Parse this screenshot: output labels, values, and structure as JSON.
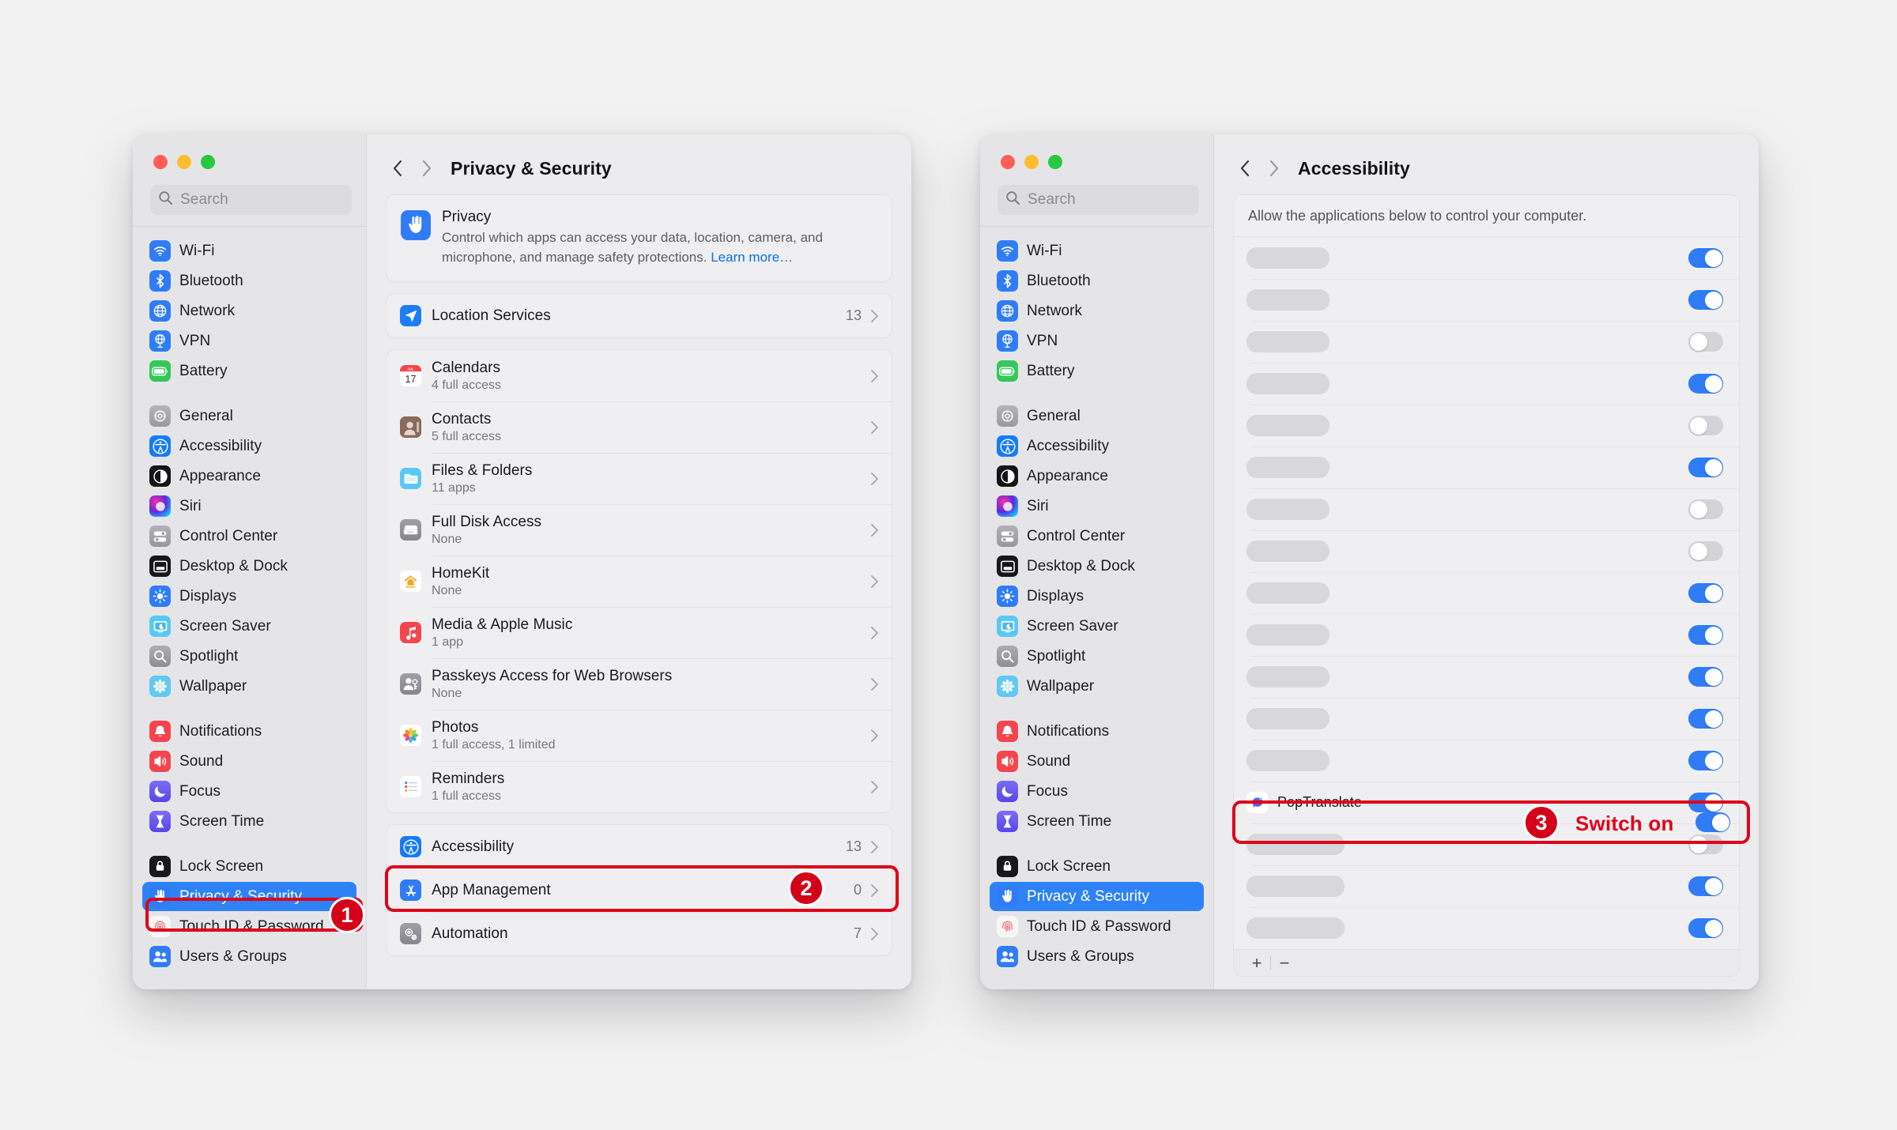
{
  "colors": {
    "accent_blue": "#2f7cf6",
    "annotation_red": "#e00018",
    "badge_red": "#d40019",
    "link_blue": "#0a6fe8",
    "desktop_bg": "#f2f2f2"
  },
  "search": {
    "placeholder": "Search"
  },
  "sidebar_groups": [
    {
      "items": [
        {
          "label": "Wi-Fi",
          "icon": "wifi-icon"
        },
        {
          "label": "Bluetooth",
          "icon": "bluetooth-icon"
        },
        {
          "label": "Network",
          "icon": "network-icon"
        },
        {
          "label": "VPN",
          "icon": "vpn-icon"
        },
        {
          "label": "Battery",
          "icon": "battery-icon"
        }
      ]
    },
    {
      "items": [
        {
          "label": "General",
          "icon": "gear-icon"
        },
        {
          "label": "Accessibility",
          "icon": "accessibility-icon"
        },
        {
          "label": "Appearance",
          "icon": "appearance-icon"
        },
        {
          "label": "Siri",
          "icon": "siri-icon"
        },
        {
          "label": "Control Center",
          "icon": "control-center-icon"
        },
        {
          "label": "Desktop & Dock",
          "icon": "desktop-dock-icon"
        },
        {
          "label": "Displays",
          "icon": "displays-icon"
        },
        {
          "label": "Screen Saver",
          "icon": "screen-saver-icon"
        },
        {
          "label": "Spotlight",
          "icon": "spotlight-icon"
        },
        {
          "label": "Wallpaper",
          "icon": "wallpaper-icon"
        }
      ]
    },
    {
      "items": [
        {
          "label": "Notifications",
          "icon": "notifications-icon"
        },
        {
          "label": "Sound",
          "icon": "sound-icon"
        },
        {
          "label": "Focus",
          "icon": "focus-icon"
        },
        {
          "label": "Screen Time",
          "icon": "screen-time-icon"
        }
      ]
    },
    {
      "items": [
        {
          "label": "Lock Screen",
          "icon": "lock-screen-icon"
        },
        {
          "label": "Privacy & Security",
          "icon": "privacy-hand-icon",
          "selected": true
        },
        {
          "label": "Touch ID & Password",
          "icon": "touch-id-icon"
        },
        {
          "label": "Users & Groups",
          "icon": "users-groups-icon"
        }
      ]
    }
  ],
  "left_window": {
    "page_title": "Privacy & Security",
    "privacy_banner": {
      "title": "Privacy",
      "description": "Control which apps can access your data, location, camera, and microphone, and manage safety protections.",
      "link": "Learn more…",
      "icon": "privacy-hand-icon"
    },
    "location_services": {
      "title": "Location Services",
      "count": "13",
      "icon": "location-icon"
    },
    "categories": [
      {
        "title": "Calendars",
        "sub": "4 full access",
        "icon": "calendar-icon"
      },
      {
        "title": "Contacts",
        "sub": "5 full access",
        "icon": "contacts-icon"
      },
      {
        "title": "Files & Folders",
        "sub": "11 apps",
        "icon": "files-folders-icon"
      },
      {
        "title": "Full Disk Access",
        "sub": "None",
        "icon": "disk-icon"
      },
      {
        "title": "HomeKit",
        "sub": "None",
        "icon": "homekit-icon"
      },
      {
        "title": "Media & Apple Music",
        "sub": "1 app",
        "icon": "music-icon"
      },
      {
        "title": "Passkeys Access for Web Browsers",
        "sub": "None",
        "icon": "passkeys-icon"
      },
      {
        "title": "Photos",
        "sub": "1 full access, 1 limited",
        "icon": "photos-icon"
      },
      {
        "title": "Reminders",
        "sub": "1 full access",
        "icon": "reminders-icon"
      }
    ],
    "highlighted_row": {
      "title": "Accessibility",
      "count": "13",
      "icon": "accessibility-icon"
    },
    "lower_rows": [
      {
        "title": "App Management",
        "count": "0",
        "icon": "app-store-icon"
      },
      {
        "title": "Automation",
        "count": "7",
        "icon": "automation-icon"
      }
    ]
  },
  "right_window": {
    "page_title": "Accessibility",
    "allow_note": "Allow the applications below to control your computer.",
    "app_rows": [
      {
        "name": "",
        "redacted": true,
        "skeleton_width": 105,
        "on": true
      },
      {
        "name": "",
        "redacted": true,
        "skeleton_width": 105,
        "on": true
      },
      {
        "name": "",
        "redacted": true,
        "skeleton_width": 105,
        "on": false
      },
      {
        "name": "",
        "redacted": true,
        "skeleton_width": 105,
        "on": true
      },
      {
        "name": "",
        "redacted": true,
        "skeleton_width": 105,
        "on": false
      },
      {
        "name": "",
        "redacted": true,
        "skeleton_width": 105,
        "on": true
      },
      {
        "name": "",
        "redacted": true,
        "skeleton_width": 105,
        "on": false
      },
      {
        "name": "",
        "redacted": true,
        "skeleton_width": 105,
        "on": false
      },
      {
        "name": "",
        "redacted": true,
        "skeleton_width": 105,
        "on": true
      },
      {
        "name": "",
        "redacted": true,
        "skeleton_width": 105,
        "on": true
      },
      {
        "name": "",
        "redacted": true,
        "skeleton_width": 105,
        "on": true
      },
      {
        "name": "",
        "redacted": true,
        "skeleton_width": 105,
        "on": true
      },
      {
        "name": "",
        "redacted": true,
        "skeleton_width": 105,
        "on": true
      },
      {
        "name": "PopTranslate",
        "redacted": false,
        "icon": "poptranslate-icon",
        "on": true,
        "highlighted": true
      },
      {
        "name": "",
        "redacted": true,
        "skeleton_width": 124,
        "on": false
      },
      {
        "name": "",
        "redacted": true,
        "skeleton_width": 124,
        "on": true
      },
      {
        "name": "",
        "redacted": true,
        "skeleton_width": 124,
        "on": true
      }
    ],
    "footer": {
      "add": "+",
      "remove": "−"
    }
  },
  "annotations": [
    {
      "id": "1",
      "badge": "1",
      "target": "sidebar-item-privacy-security"
    },
    {
      "id": "2",
      "badge": "2",
      "target": "row-accessibility"
    },
    {
      "id": "3",
      "badge": "3",
      "target": "app-row-poptranslate",
      "text": "Switch on"
    }
  ]
}
